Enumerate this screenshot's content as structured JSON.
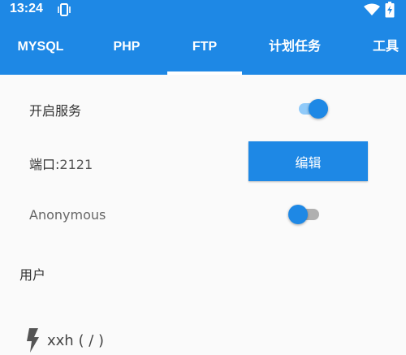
{
  "status_bar": {
    "time": "13:24",
    "icons": [
      "vibrate-icon",
      "wifi-icon",
      "battery-charging-icon"
    ]
  },
  "tabs": [
    {
      "label": "MYSQL",
      "selected": false
    },
    {
      "label": "PHP",
      "selected": false
    },
    {
      "label": "FTP",
      "selected": true
    },
    {
      "label": "计划任务",
      "selected": false
    },
    {
      "label": "工具",
      "selected": false
    }
  ],
  "ftp": {
    "service_label": "开启服务",
    "service_enabled": true,
    "port_label": "端口:",
    "port_value": "2121",
    "edit_label": "编辑",
    "anonymous_label": "Anonymous",
    "anonymous_enabled": false
  },
  "users": {
    "section_title": "用户",
    "items": [
      {
        "icon": "bolt-icon",
        "name": "xxh",
        "path": "( / )"
      }
    ]
  },
  "colors": {
    "primary": "#1e88e5",
    "switch_on_track": "#90caf9",
    "switch_off_track": "#b0b0b0",
    "background": "#fafafa"
  }
}
